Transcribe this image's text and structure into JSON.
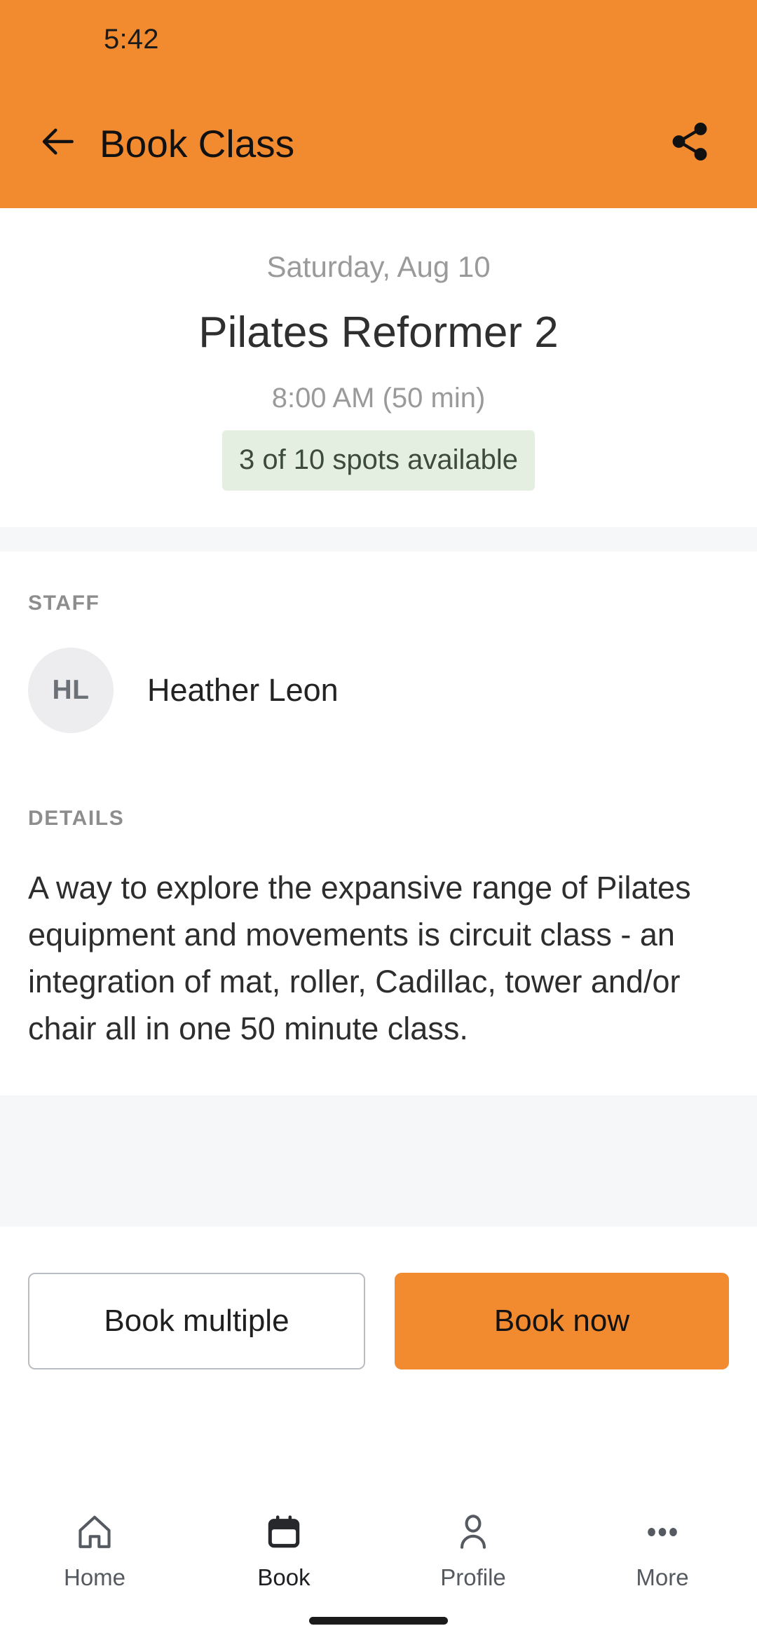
{
  "colors": {
    "brand_orange": "#f28b30",
    "badge_green_bg": "#e4efe2",
    "badge_green_text": "#3c4b3c",
    "band_gray": "#f6f7f9",
    "avatar_gray": "#ededf0"
  },
  "status_bar": {
    "time": "5:42"
  },
  "app_bar": {
    "title": "Book Class",
    "back_icon": "arrow-left-icon",
    "share_icon": "share-icon"
  },
  "hero": {
    "date": "Saturday, Aug 10",
    "class_name": "Pilates Reformer 2",
    "time": "8:00 AM (50 min)",
    "spots_badge": "3 of 10 spots available",
    "spots_available": 3,
    "spots_total": 10
  },
  "staff": {
    "label": "STAFF",
    "members": [
      {
        "initials": "HL",
        "name": "Heather Leon"
      }
    ]
  },
  "details": {
    "label": "DETAILS",
    "body": "A way to explore the expansive range of Pilates equipment and movements is circuit class - an integration of mat, roller, Cadillac, tower and/or chair all in one 50 minute class."
  },
  "actions": {
    "secondary_label": "Book multiple",
    "primary_label": "Book now"
  },
  "bottom_nav": {
    "items": [
      {
        "label": "Home",
        "icon": "home-icon",
        "active": false
      },
      {
        "label": "Book",
        "icon": "calendar-icon",
        "active": true
      },
      {
        "label": "Profile",
        "icon": "person-icon",
        "active": false
      },
      {
        "label": "More",
        "icon": "ellipsis-icon",
        "active": false
      }
    ]
  }
}
